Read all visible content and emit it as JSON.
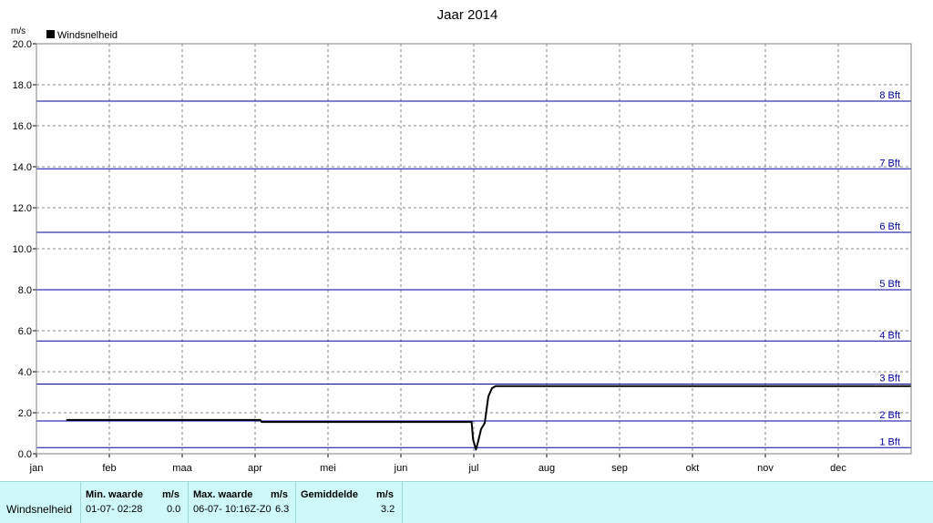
{
  "chart_data": {
    "type": "line",
    "title": "Jaar 2014",
    "ylabel": "m/s",
    "ylim": [
      0,
      20
    ],
    "yticks": [
      "0.0",
      "2.0",
      "4.0",
      "6.0",
      "8.0",
      "10.0",
      "12.0",
      "14.0",
      "16.0",
      "18.0",
      "20.0"
    ],
    "months": [
      "jan",
      "feb",
      "maa",
      "apr",
      "mei",
      "jun",
      "jul",
      "aug",
      "sep",
      "okt",
      "nov",
      "dec"
    ],
    "xlim": [
      0,
      12
    ],
    "grid": true,
    "legend": "top-left",
    "series": [
      {
        "name": "Windsnelheid",
        "color": "#000000",
        "x": [
          0.41,
          3.07,
          3.09,
          5.97,
          5.99,
          6.03,
          6.06,
          6.1,
          6.15,
          6.2,
          6.25,
          6.3,
          6.35,
          12.0
        ],
        "y": [
          1.65,
          1.65,
          1.55,
          1.55,
          0.7,
          0.2,
          0.6,
          1.2,
          1.5,
          2.8,
          3.2,
          3.3,
          3.3,
          3.3
        ]
      }
    ],
    "reference_lines": [
      {
        "label": "1 Bft",
        "value": 0.3
      },
      {
        "label": "2 Bft",
        "value": 1.6
      },
      {
        "label": "3 Bft",
        "value": 3.4
      },
      {
        "label": "4 Bft",
        "value": 5.5
      },
      {
        "label": "5 Bft",
        "value": 8.0
      },
      {
        "label": "6 Bft",
        "value": 10.8
      },
      {
        "label": "7 Bft",
        "value": 13.9
      },
      {
        "label": "8 Bft",
        "value": 17.2
      }
    ],
    "reference_color": "#0000a0"
  },
  "stats": {
    "row_label": "Windsnelheid",
    "min_header": "Min. waarde",
    "min_unit": "m/s",
    "min_date": "01-07-  02:28",
    "min_value": "0.0",
    "max_header": "Max. waarde",
    "max_unit": "m/s",
    "max_date": "06-07-  10:16Z-Z0",
    "max_value": "6.3",
    "avg_header": "Gemiddelde",
    "avg_unit": "m/s",
    "avg_value": "3.2"
  }
}
